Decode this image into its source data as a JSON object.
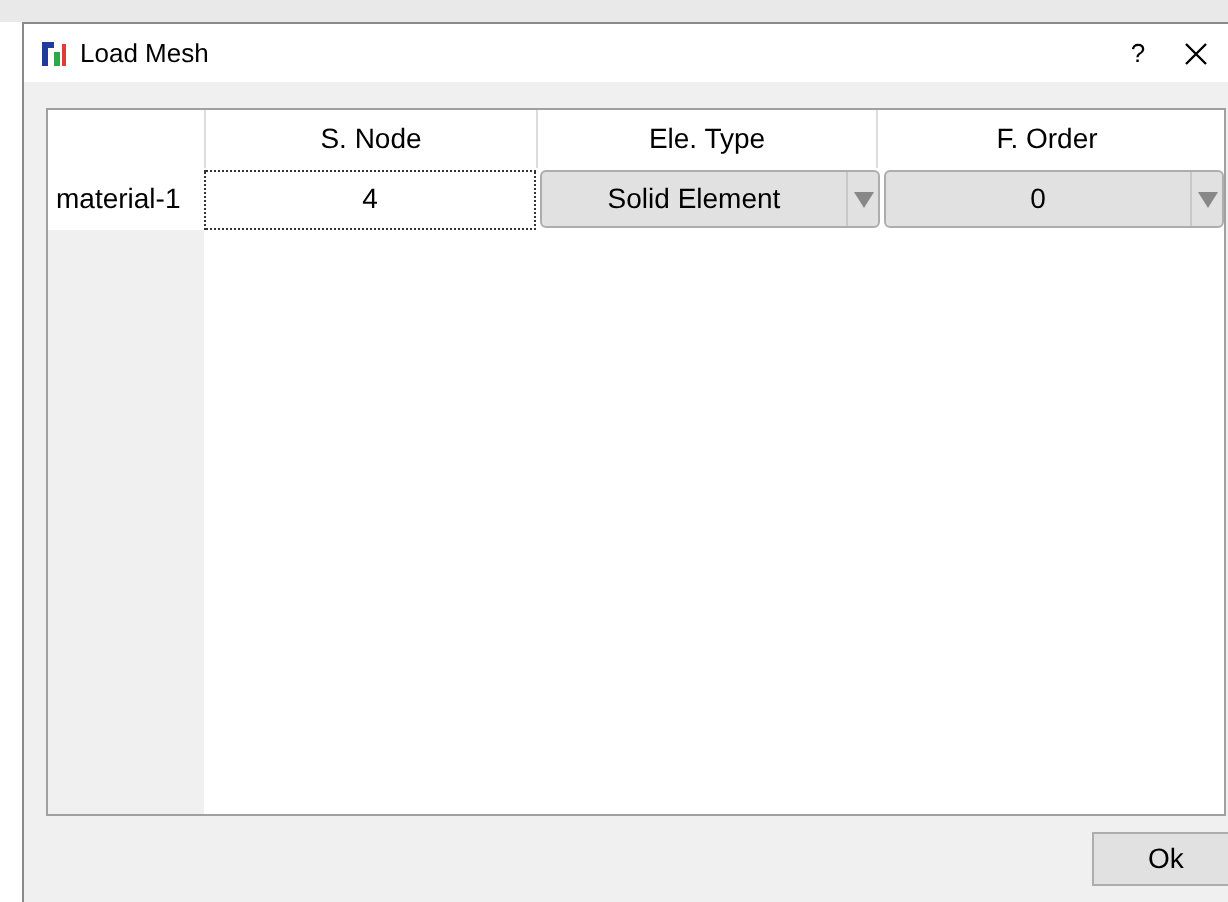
{
  "window": {
    "title": "Load Mesh",
    "help": "?"
  },
  "table": {
    "columns": [
      "S. Node",
      "Ele. Type",
      "F. Order"
    ],
    "rows": [
      {
        "header": "material-1",
        "cells": [
          {
            "kind": "edit",
            "value": "4"
          },
          {
            "kind": "combo",
            "value": "Solid Element"
          },
          {
            "kind": "combo",
            "value": "0"
          }
        ]
      }
    ]
  },
  "buttons": [
    "Ok"
  ]
}
